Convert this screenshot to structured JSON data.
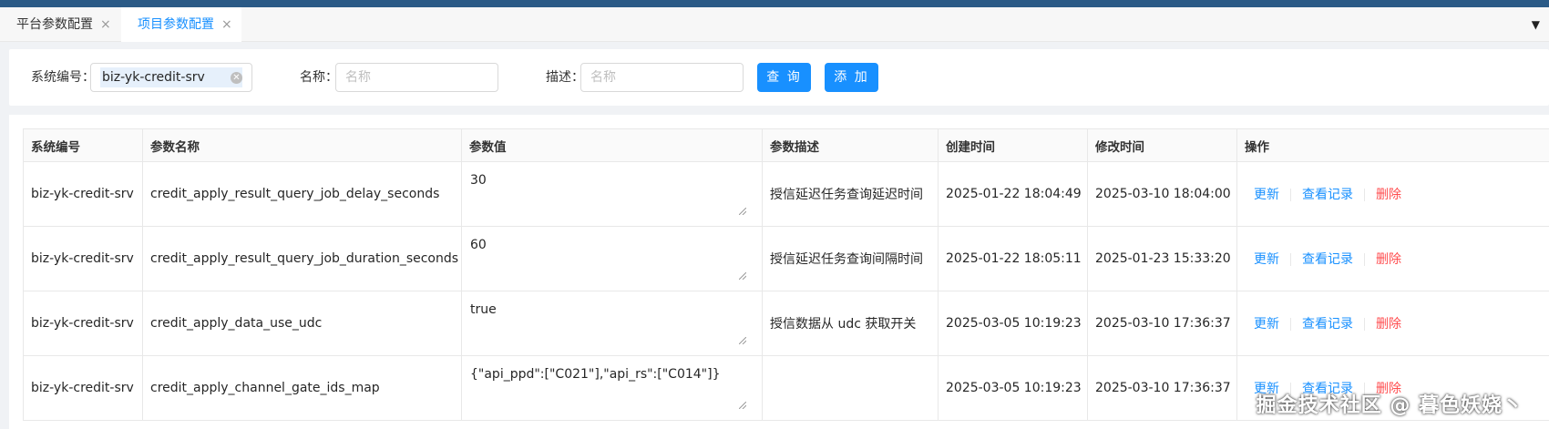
{
  "tabs": [
    {
      "label": "平台参数配置",
      "active": false
    },
    {
      "label": "项目参数配置",
      "active": true
    }
  ],
  "tab_close_glyph": "×",
  "filters": {
    "system_label": "系统编号：",
    "system_value": "biz-yk-credit-srv",
    "name_label": "名称：",
    "name_placeholder": "名称",
    "desc_label": "描述：",
    "desc_placeholder": "名称",
    "query_button": "查 询",
    "add_button": "添 加"
  },
  "table": {
    "columns": [
      "系统编号",
      "参数名称",
      "参数值",
      "参数描述",
      "创建时间",
      "修改时间",
      "操作"
    ],
    "rows": [
      {
        "system": "biz-yk-credit-srv",
        "name": "credit_apply_result_query_job_delay_seconds",
        "value": "30",
        "desc": "授信延迟任务查询延迟时间",
        "created": "2025-01-22 18:04:49",
        "modified": "2025-03-10 18:04:00"
      },
      {
        "system": "biz-yk-credit-srv",
        "name": "credit_apply_result_query_job_duration_seconds",
        "value": "60",
        "desc": "授信延迟任务查询间隔时间",
        "created": "2025-01-22 18:05:11",
        "modified": "2025-01-23 15:33:20"
      },
      {
        "system": "biz-yk-credit-srv",
        "name": "credit_apply_data_use_udc",
        "value": "true",
        "desc": "授信数据从 udc 获取开关",
        "created": "2025-03-05 10:19:23",
        "modified": "2025-03-10 17:36:37"
      },
      {
        "system": "biz-yk-credit-srv",
        "name": "credit_apply_channel_gate_ids_map",
        "value": "{\"api_ppd\":[\"C021\"],\"api_rs\":[\"C014\"]}",
        "desc": "",
        "created": "2025-03-05 10:19:23",
        "modified": "2025-03-10 17:36:37"
      }
    ],
    "actions": {
      "update": "更新",
      "history": "查看记录",
      "delete": "删除"
    }
  },
  "watermark": "掘金技术社区 @ 暮色妖娆丶",
  "colors": {
    "accent": "#1890ff",
    "danger": "#ff4d4f",
    "topbar": "#2b5a86"
  }
}
